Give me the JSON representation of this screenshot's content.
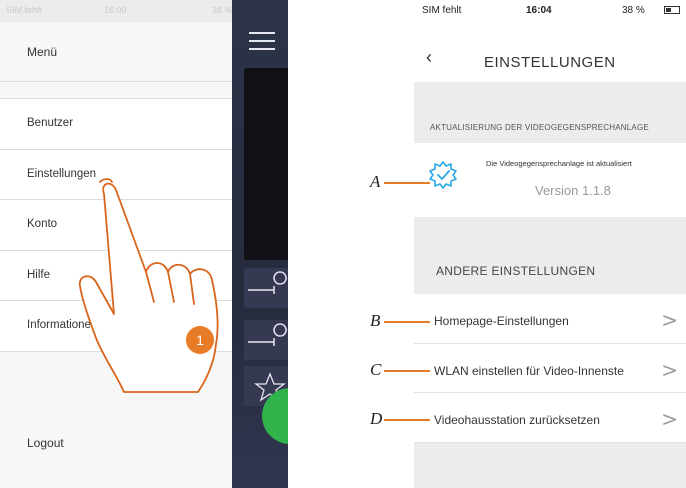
{
  "left_phone": {
    "status": {
      "carrier": "SIM fehlt",
      "time": "16:00",
      "battery": "38 %"
    },
    "menu": {
      "title": "Menü",
      "items": [
        {
          "label": "Benutzer"
        },
        {
          "label": "Einstellungen"
        },
        {
          "label": "Konto"
        },
        {
          "label": "Hilfe"
        },
        {
          "label": "Informationen"
        }
      ],
      "logout": "Logout"
    },
    "step_badge": "1"
  },
  "right_phone": {
    "status": {
      "carrier": "SIM fehlt",
      "time": "16:04",
      "battery": "38 %"
    },
    "header": {
      "back_icon": "‹",
      "title": "EINSTELLUNGEN"
    },
    "update_section": {
      "title": "AKTUALISIERUNG DER VIDEOGEGENSPRECHANLAGE",
      "status_text": "Die Videogegensprechanlage ist aktualisiert",
      "version": "Version 1.1.8",
      "icon": "gear-check-icon"
    },
    "other_section": {
      "title": "ANDERE EINSTELLUNGEN",
      "items": [
        {
          "label": "Homepage-Einstellungen",
          "chevron": ">"
        },
        {
          "label": "WLAN einstellen für Video-Innenste",
          "chevron": ">"
        },
        {
          "label": "Videohausstation zurücksetzen",
          "chevron": ">"
        }
      ]
    }
  },
  "callouts": [
    "A",
    "B",
    "C",
    "D"
  ],
  "colors": {
    "accent": "#e87b26",
    "icon_blue": "#2aa6e8",
    "call_green": "#2fb34a"
  }
}
